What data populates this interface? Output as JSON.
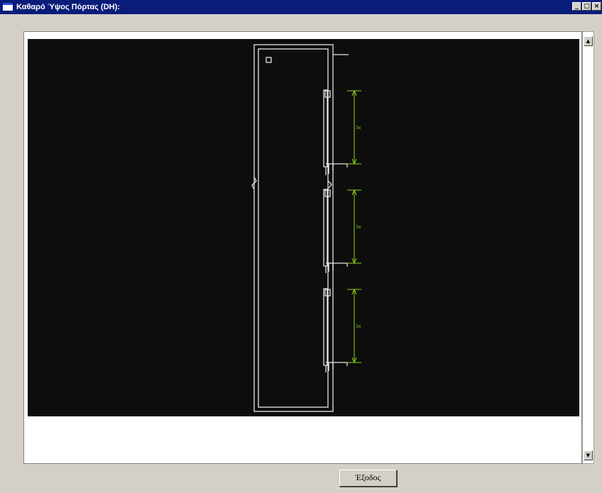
{
  "window": {
    "title": "Καθαρό Ύψος Πόρτας (DH):",
    "controls": {
      "minimize": "_",
      "maximize": "□",
      "close": "×"
    }
  },
  "drawing": {
    "background_color": "#0d0d0d",
    "line_color": "#e6e6e6",
    "dimension_color": "#8fd21a",
    "dimensions": [
      {
        "label": "3x"
      },
      {
        "label": "3x"
      },
      {
        "label": "3x"
      }
    ]
  },
  "scrollbar": {
    "up_arrow": "▲",
    "down_arrow": "▼"
  },
  "footer": {
    "exit_label": "Έξοδος"
  }
}
